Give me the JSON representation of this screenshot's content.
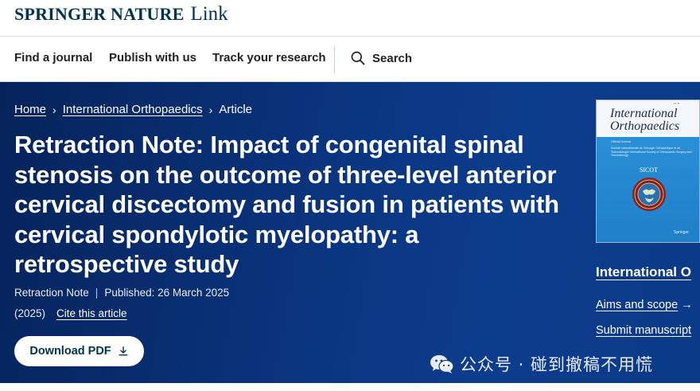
{
  "brand": {
    "name": "SPRINGER NATURE",
    "product": "Link",
    "color": "#01324b"
  },
  "nav": {
    "items": [
      {
        "label": "Find a journal"
      },
      {
        "label": "Publish with us"
      },
      {
        "label": "Track your research"
      }
    ],
    "search_label": "Search"
  },
  "breadcrumb": {
    "home": "Home",
    "journal": "International Orthopaedics",
    "current": "Article",
    "separator": "›"
  },
  "article": {
    "title": "Retraction Note: Impact of congenital spinal stenosis on the outcome of three-level anterior cervical discectomy and fusion in patients with cervical spondylotic myelopathy: a retrospective study",
    "type": "Retraction Note",
    "published": "Published: 26 March 2025",
    "year": "(2025)",
    "cite_label": "Cite this article",
    "download_label": "Download PDF"
  },
  "journal": {
    "cover_title": "International Orthopaedics",
    "cover_official": "Official Journal",
    "cover_society": "Société Internationale de Chirurgie Orthopédique et de Traumatologie International Society of Orthopaedic Surgery and Traumatology",
    "cover_sicot": "SICOT",
    "cover_publisher": "Springer",
    "name": "International O",
    "aims_label": "Aims and scope",
    "aims_arrow": "→",
    "submit_label": "Submit manuscript"
  },
  "watermark": {
    "text": "公众号 · 碰到撤稿不用慌"
  },
  "colors": {
    "hero_dark": "#05235a",
    "hero_light": "#0c3c8c",
    "accent_white": "#ffffff"
  }
}
